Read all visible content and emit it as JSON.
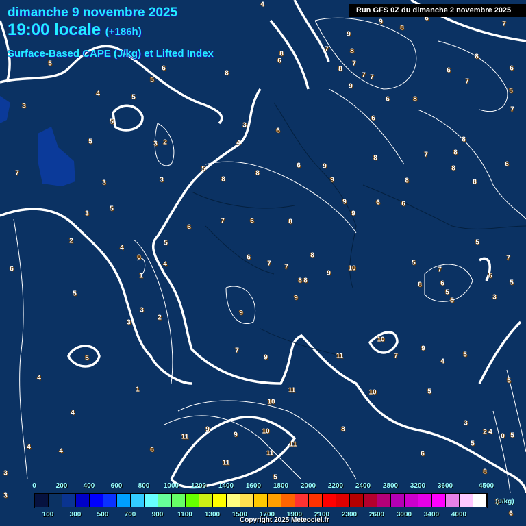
{
  "header": {
    "date": "dimanche 9 novembre 2025",
    "time": "19:00 locale",
    "offset": "(+186h)",
    "product": "Surface-Based CAPE (J/kg) et Lifted Index",
    "run": "Run GFS 0Z du dimanche 2 novembre 2025"
  },
  "map": {
    "background_color": "#0b3263",
    "cape_blue_color": "#0b3a9a",
    "lifted_index_labels": [
      "4",
      "3",
      "5",
      "4",
      "5",
      "6",
      "5",
      "5",
      "5",
      "3",
      "2",
      "7",
      "3",
      "3",
      "3",
      "5",
      "2",
      "4",
      "0",
      "4",
      "1",
      "5",
      "6",
      "5",
      "3",
      "2",
      "3",
      "5",
      "4",
      "1",
      "4",
      "4",
      "4",
      "6",
      "11",
      "9",
      "9",
      "10",
      "11",
      "11",
      "11",
      "5",
      "3",
      "3",
      "8",
      "3",
      "4",
      "5",
      "8",
      "8",
      "6",
      "6",
      "8",
      "6",
      "9",
      "9",
      "9",
      "9",
      "6",
      "7",
      "6",
      "8",
      "6",
      "7",
      "7",
      "8",
      "8",
      "8",
      "9",
      "10",
      "9",
      "9",
      "7",
      "9",
      "11",
      "11",
      "10",
      "10",
      "8",
      "10",
      "7",
      "9",
      "4",
      "5",
      "5",
      "9",
      "9",
      "8",
      "7",
      "8",
      "8",
      "7",
      "7",
      "7",
      "9",
      "6",
      "8",
      "6",
      "8",
      "8",
      "6",
      "6",
      "7",
      "8",
      "8",
      "8",
      "6",
      "8",
      "6",
      "7",
      "8",
      "6",
      "5",
      "7",
      "7",
      "6",
      "5",
      "7",
      "5",
      "7",
      "8",
      "6",
      "5",
      "5",
      "5",
      "5",
      "3",
      "5",
      "3",
      "4",
      "2",
      "0",
      "5",
      "5",
      "6",
      "8",
      "2",
      "6"
    ]
  },
  "legend": {
    "top_ticks": [
      "0",
      "200",
      "400",
      "600",
      "800",
      "1000",
      "1200",
      "1400",
      "1600",
      "1800",
      "2000",
      "2200",
      "2400",
      "2800",
      "3200",
      "3600",
      "4500"
    ],
    "bottom_ticks": [
      "100",
      "300",
      "500",
      "700",
      "900",
      "1100",
      "1300",
      "1500",
      "1700",
      "1900",
      "2100",
      "2300",
      "2600",
      "3000",
      "3400",
      "4000"
    ],
    "unit": "(J/kg)",
    "colors": [
      "#06123f",
      "#0b3263",
      "#0a3490",
      "#0000c8",
      "#0000ff",
      "#0a32ff",
      "#00a0ff",
      "#33ccff",
      "#66ffff",
      "#66ff99",
      "#66ff66",
      "#66ff00",
      "#ccf014",
      "#ffff00",
      "#ffff80",
      "#ffe050",
      "#ffc800",
      "#ffa000",
      "#ff6400",
      "#ff3232",
      "#ff3200",
      "#ff0000",
      "#e00000",
      "#b40000",
      "#b4002d",
      "#b40078",
      "#b400b4",
      "#cc00cc",
      "#e600e6",
      "#ff00ff",
      "#e680e6",
      "#ffc8ff",
      "#ffffff"
    ]
  },
  "footer": {
    "copyright": "Copyright 2025 Meteociel.fr"
  }
}
